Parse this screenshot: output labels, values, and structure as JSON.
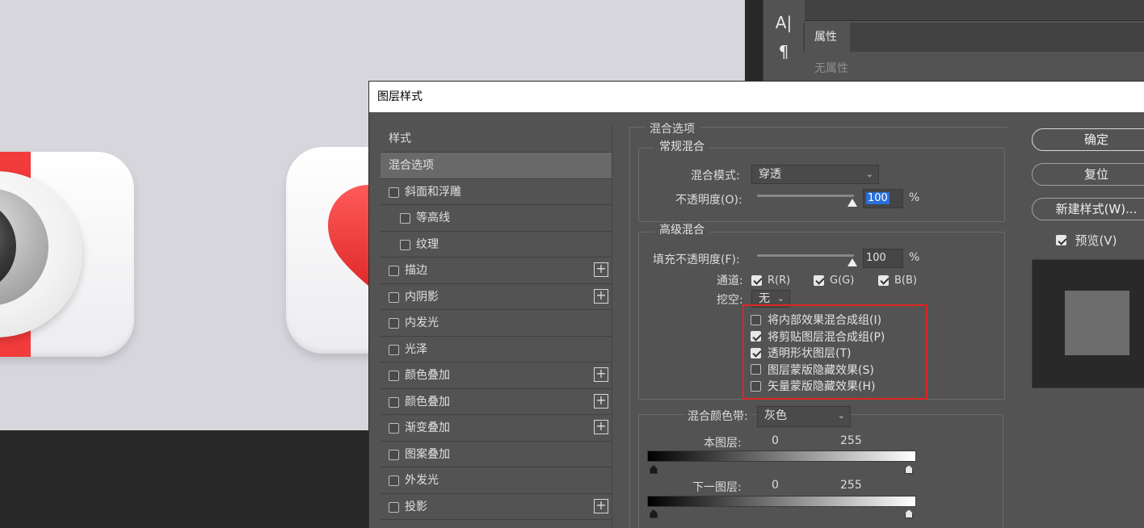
{
  "tool_strip": {
    "type_tool": "A|",
    "paragraph_tool": "¶"
  },
  "properties_panel": {
    "tab_label": "属性",
    "empty_text": "无属性"
  },
  "dialog": {
    "title": "图层样式",
    "style_list": {
      "header": "样式",
      "items": [
        {
          "label": "混合选项",
          "checked": false,
          "selected": true,
          "indent": false,
          "has_plus": false,
          "has_checkbox": false
        },
        {
          "label": "斜面和浮雕",
          "checked": false,
          "selected": false,
          "indent": false,
          "has_plus": false,
          "has_checkbox": true
        },
        {
          "label": "等高线",
          "checked": false,
          "selected": false,
          "indent": true,
          "has_plus": false,
          "has_checkbox": true
        },
        {
          "label": "纹理",
          "checked": false,
          "selected": false,
          "indent": true,
          "has_plus": false,
          "has_checkbox": true
        },
        {
          "label": "描边",
          "checked": false,
          "selected": false,
          "indent": false,
          "has_plus": true,
          "has_checkbox": true
        },
        {
          "label": "内阴影",
          "checked": false,
          "selected": false,
          "indent": false,
          "has_plus": true,
          "has_checkbox": true
        },
        {
          "label": "内发光",
          "checked": false,
          "selected": false,
          "indent": false,
          "has_plus": false,
          "has_checkbox": true
        },
        {
          "label": "光泽",
          "checked": false,
          "selected": false,
          "indent": false,
          "has_plus": false,
          "has_checkbox": true
        },
        {
          "label": "颜色叠加",
          "checked": false,
          "selected": false,
          "indent": false,
          "has_plus": true,
          "has_checkbox": true
        },
        {
          "label": "颜色叠加",
          "checked": false,
          "selected": false,
          "indent": false,
          "has_plus": true,
          "has_checkbox": true
        },
        {
          "label": "渐变叠加",
          "checked": false,
          "selected": false,
          "indent": false,
          "has_plus": true,
          "has_checkbox": true
        },
        {
          "label": "图案叠加",
          "checked": false,
          "selected": false,
          "indent": false,
          "has_plus": false,
          "has_checkbox": true
        },
        {
          "label": "外发光",
          "checked": false,
          "selected": false,
          "indent": false,
          "has_plus": false,
          "has_checkbox": true
        },
        {
          "label": "投影",
          "checked": false,
          "selected": false,
          "indent": false,
          "has_plus": true,
          "has_checkbox": true
        }
      ],
      "plus_symbol": "+"
    },
    "blend_options": {
      "section_title": "混合选项",
      "general": {
        "title": "常规混合",
        "blend_mode_label": "混合模式:",
        "blend_mode_value": "穿透",
        "opacity_label": "不透明度(O):",
        "opacity_value": "100",
        "opacity_slider": 100,
        "percent": "%"
      },
      "advanced": {
        "title": "高级混合",
        "fill_opacity_label": "填充不透明度(F):",
        "fill_opacity_value": "100",
        "fill_opacity_slider": 100,
        "percent": "%",
        "channels_label": "通道:",
        "channels": [
          {
            "label": "R(R)",
            "checked": true
          },
          {
            "label": "G(G)",
            "checked": true
          },
          {
            "label": "B(B)",
            "checked": true
          }
        ],
        "knockout_label": "挖空:",
        "knockout_value": "无",
        "options": [
          {
            "label": "将内部效果混合成组(I)",
            "checked": false
          },
          {
            "label": "将剪贴图层混合成组(P)",
            "checked": true
          },
          {
            "label": "透明形状图层(T)",
            "checked": true
          },
          {
            "label": "图层蒙版隐藏效果(S)",
            "checked": false
          },
          {
            "label": "矢量蒙版隐藏效果(H)",
            "checked": false
          }
        ]
      },
      "blend_if": {
        "label": "混合颜色带:",
        "value": "灰色",
        "this_layer_label": "本图层:",
        "this_layer_low": "0",
        "this_layer_high": "255",
        "underlying_label": "下一图层:",
        "underlying_low": "0",
        "underlying_high": "255"
      }
    },
    "buttons": {
      "ok": "确定",
      "reset": "复位",
      "new_style": "新建样式(W)...",
      "preview_label": "预览(V)",
      "preview_checked": true
    }
  },
  "colors": {
    "highlight_box": "#e02424",
    "dialog_bg": "#535353",
    "canvas_bg": "#d6d6dc",
    "heart_red": "#f23b3b"
  }
}
